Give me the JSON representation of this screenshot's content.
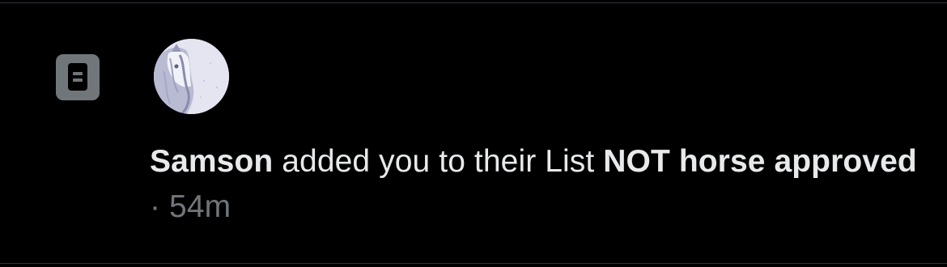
{
  "notification": {
    "icon": "list-icon",
    "avatar": "horse-avatar",
    "user_name": "Samson",
    "action_text": " added you to their List ",
    "list_name": "NOT horse approved",
    "separator": " · ",
    "time_ago": "54m"
  },
  "colors": {
    "background": "#000000",
    "text_primary": "#e7e9ea",
    "text_muted": "#71767b",
    "divider": "#2f3336"
  }
}
